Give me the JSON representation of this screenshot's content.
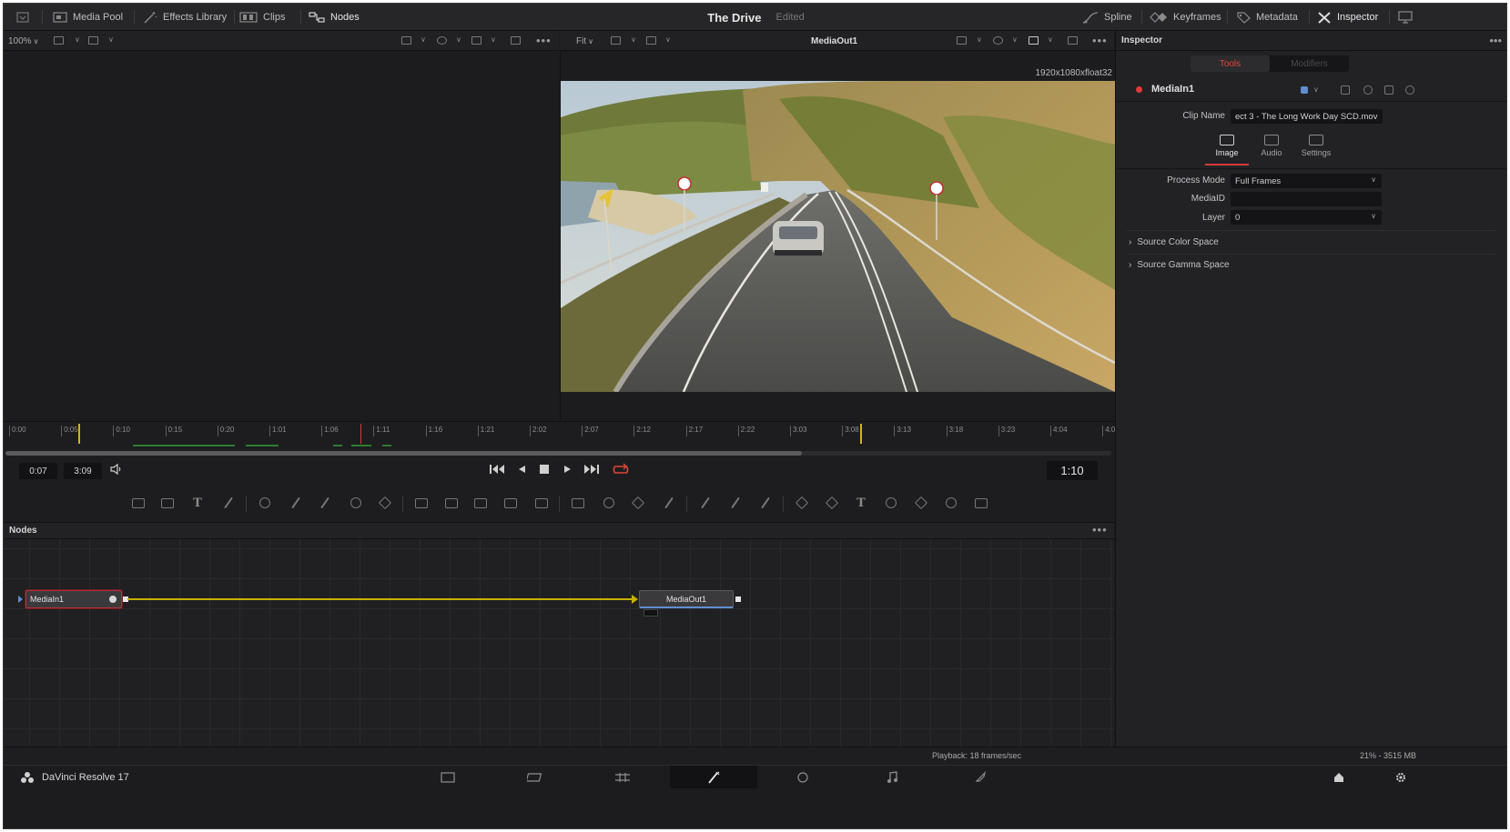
{
  "topbar": {
    "media_pool": "Media Pool",
    "effects_library": "Effects Library",
    "clips": "Clips",
    "nodes": "Nodes",
    "project_title": "The Drive",
    "project_status": "Edited",
    "spline": "Spline",
    "keyframes": "Keyframes",
    "metadata": "Metadata",
    "inspector": "Inspector"
  },
  "viewer_left": {
    "zoom": "100%"
  },
  "viewer_right": {
    "fit": "Fit",
    "title": "MediaOut1",
    "resolution": "1920x1080xfloat32"
  },
  "ruler": {
    "ticks": [
      "0:00",
      "0:05",
      "0:10",
      "0:15",
      "0:20",
      "1:01",
      "1:06",
      "1:11",
      "1:16",
      "1:21",
      "2:02",
      "2:07",
      "2:12",
      "2:17",
      "2:22",
      "3:03",
      "3:08",
      "3:13",
      "3:18",
      "3:23",
      "4:04",
      "4:0"
    ]
  },
  "scrubber": {
    "progress": 0.72
  },
  "transport": {
    "start": "0:07",
    "end": "3:09",
    "current": "1:10"
  },
  "nodes_panel": {
    "title": "Nodes",
    "media_in": "MediaIn1",
    "media_out": "MediaOut1"
  },
  "status": {
    "playback": "Playback: 18 frames/sec",
    "memory": "21% - 3515 MB"
  },
  "pagebar": {
    "app_name": "DaVinci Resolve 17",
    "active_page": "fusion"
  },
  "inspector": {
    "title": "Inspector",
    "tab_tools": "Tools",
    "tab_modifiers": "Modifiers",
    "node_name": "MediaIn1",
    "clip_name_label": "Clip Name",
    "clip_name_value": "ect 3 - The Long Work Day SCD.mov",
    "subtab_image": "Image",
    "subtab_audio": "Audio",
    "subtab_settings": "Settings",
    "process_mode_label": "Process Mode",
    "process_mode_value": "Full Frames",
    "mediaid_label": "MediaID",
    "mediaid_value": "",
    "layer_label": "Layer",
    "layer_value": "0",
    "source_color_space": "Source Color Space",
    "source_gamma_space": "Source Gamma Space"
  },
  "colors": {
    "accent_red": "#e0453b",
    "wire_yellow": "#c8b000",
    "selection_blue": "#5f8fcf"
  }
}
